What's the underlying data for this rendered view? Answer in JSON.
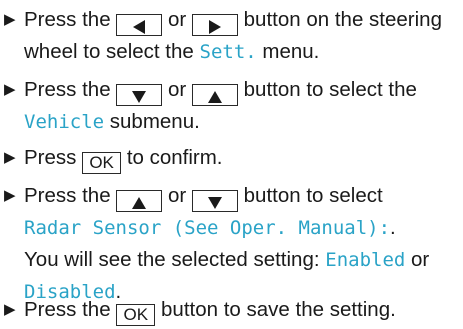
{
  "steps": [
    {
      "part1": "Press the",
      "or": "or",
      "part2": "button on the steering wheel to select the",
      "menu": "Sett.",
      "part3": "menu.",
      "key1_icon": "triangle-left-icon",
      "key2_icon": "triangle-right-icon"
    },
    {
      "part1": "Press the",
      "or": "or",
      "part2": "button to select the",
      "menu": "Vehicle",
      "part3": "submenu.",
      "key1_icon": "triangle-down-icon",
      "key2_icon": "triangle-up-icon"
    },
    {
      "part1": "Press",
      "key": "OK",
      "part2": "to confirm."
    },
    {
      "part1": "Press the",
      "or": "or",
      "part2": "button to select",
      "menu": "Radar Sensor (See Oper. Manual):",
      "part3": ".",
      "part4": "You will see the selected setting:",
      "opt1": "Enabled",
      "or2": "or",
      "opt2": "Disabled",
      "part5": ".",
      "key1_icon": "triangle-up-icon",
      "key2_icon": "triangle-down-icon"
    },
    {
      "part1": "Press the",
      "key": "OK",
      "part2": "button to save the setting."
    }
  ],
  "bullet_icon": "bullet-triangle-icon",
  "colors": {
    "menu_text": "#2aa3c7",
    "body_text": "#1a1a1a"
  }
}
